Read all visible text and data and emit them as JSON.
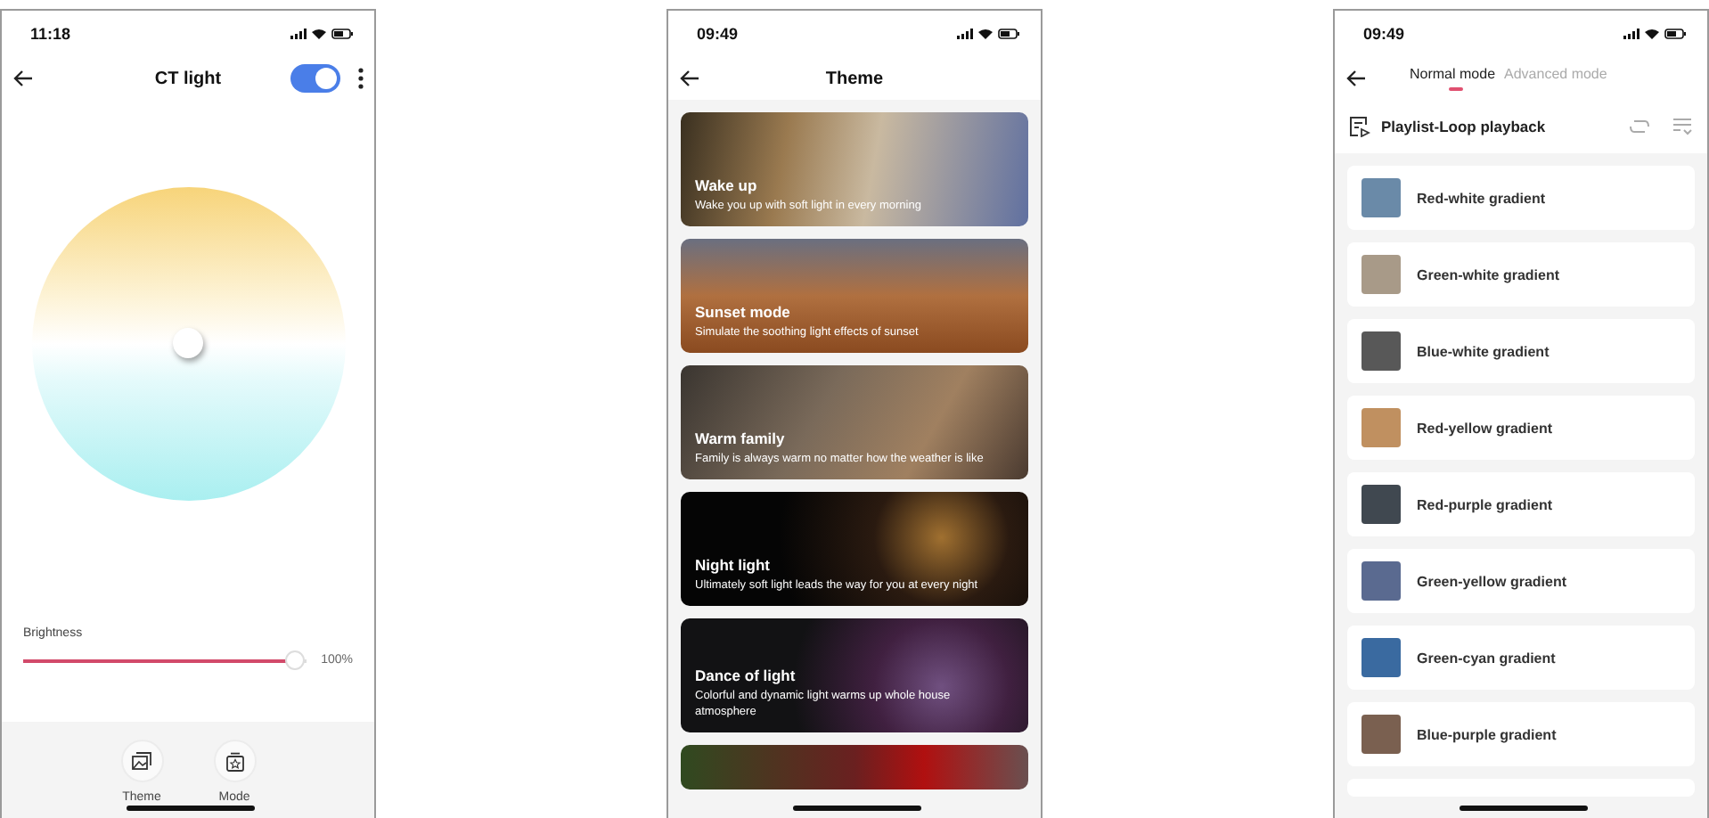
{
  "control_screen": {
    "status_time": "11:18",
    "title": "CT light",
    "power_on": true,
    "brightness": {
      "label": "Brightness",
      "level": 1,
      "reading": "100%"
    },
    "bottom_buttons": [
      {
        "label": "Theme",
        "kind": "theme"
      },
      {
        "label": "Mode",
        "kind": "mode"
      }
    ]
  },
  "theme_screen": {
    "status_time": "09:49",
    "title": "Theme",
    "themes": [
      {
        "title": "Wake up",
        "description": "Wake you up with soft light in every morning"
      },
      {
        "title": "Sunset mode",
        "description": "Simulate the soothing light effects of sunset"
      },
      {
        "title": "Warm family",
        "description": "Family is always warm no matter how the weather is like"
      },
      {
        "title": "Night light",
        "description": "Ultimately soft light leads the way for you at every night"
      },
      {
        "title": "Dance of light",
        "description": "Colorful and dynamic light warms up whole house atmosphere"
      }
    ]
  },
  "playlist_screen": {
    "status_time": "09:49",
    "tabs": [
      {
        "label": "Normal mode",
        "selected": true
      },
      {
        "label": "Advanced mode",
        "selected": false
      }
    ],
    "playlist_title": "Playlist-Loop playback",
    "scenes": [
      "Red-white gradient",
      "Green-white gradient",
      "Blue-white gradient",
      "Red-yellow gradient",
      "Red-purple gradient",
      "Green-yellow gradient",
      "Green-cyan gradient",
      "Blue-purple gradient"
    ]
  }
}
